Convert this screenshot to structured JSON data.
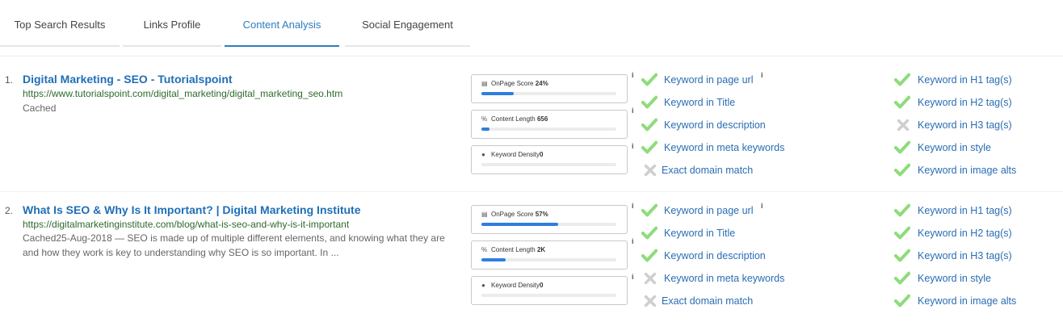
{
  "tabs": [
    {
      "label": "Top Search Results"
    },
    {
      "label": "Links Profile"
    },
    {
      "label": "Content Analysis"
    },
    {
      "label": "Social Engagement"
    }
  ],
  "results": [
    {
      "number": "1.",
      "title": "Digital Marketing - SEO - Tutorialspoint",
      "url": "https://www.tutorialspoint.com/digital_marketing/digital_marketing_seo.htm",
      "snippet": "Cached",
      "metrics": [
        {
          "icon": "bar-chart-icon",
          "label": "OnPage Score",
          "value": "24%",
          "progress": 0.24
        },
        {
          "icon": "link-icon",
          "label": "Content Length",
          "value": "656",
          "progress": 0.06
        },
        {
          "icon": "globe-icon",
          "label": "Keyword Density",
          "value": "0",
          "progress": 0
        }
      ],
      "left_checks": [
        {
          "label": "Keyword in page url",
          "pass": true
        },
        {
          "label": "Keyword in Title",
          "pass": true
        },
        {
          "label": "Keyword in description",
          "pass": true
        },
        {
          "label": "Keyword in meta keywords",
          "pass": true
        },
        {
          "label": "Exact domain match",
          "pass": false
        }
      ],
      "right_checks": [
        {
          "label": "Keyword in H1 tag(s)",
          "pass": true
        },
        {
          "label": "Keyword in H2 tag(s)",
          "pass": true
        },
        {
          "label": "Keyword in H3 tag(s)",
          "pass": false
        },
        {
          "label": "Keyword in style",
          "pass": true
        },
        {
          "label": "Keyword in image alts",
          "pass": true
        }
      ]
    },
    {
      "number": "2.",
      "title": "What Is SEO & Why Is It Important? | Digital Marketing Institute",
      "url": "https://digitalmarketinginstitute.com/blog/what-is-seo-and-why-is-it-important",
      "snippet": "Cached25-Aug-2018 — SEO is made up of multiple different elements, and knowing what they are and how they work is key to understanding why SEO is so important. In ...",
      "metrics": [
        {
          "icon": "bar-chart-icon",
          "label": "OnPage Score",
          "value": "57%",
          "progress": 0.57
        },
        {
          "icon": "link-icon",
          "label": "Content Length",
          "value": "2K",
          "progress": 0.18
        },
        {
          "icon": "globe-icon",
          "label": "Keyword Density",
          "value": "0",
          "progress": 0
        }
      ],
      "left_checks": [
        {
          "label": "Keyword in page url",
          "pass": true
        },
        {
          "label": "Keyword in Title",
          "pass": true
        },
        {
          "label": "Keyword in description",
          "pass": true
        },
        {
          "label": "Keyword in meta keywords",
          "pass": false
        },
        {
          "label": "Exact domain match",
          "pass": false
        }
      ],
      "right_checks": [
        {
          "label": "Keyword in H1 tag(s)",
          "pass": true
        },
        {
          "label": "Keyword in H2 tag(s)",
          "pass": true
        },
        {
          "label": "Keyword in H3 tag(s)",
          "pass": true
        },
        {
          "label": "Keyword in style",
          "pass": true
        },
        {
          "label": "Keyword in image alts",
          "pass": true
        }
      ]
    }
  ],
  "info_glyph": "i",
  "colors": {
    "accent": "#2e7dbf",
    "link": "#1f6fb7",
    "url": "#2e6a2e",
    "pass": "#8edc7c",
    "fail": "#cfcfcf",
    "bar": "#2f7de1"
  }
}
